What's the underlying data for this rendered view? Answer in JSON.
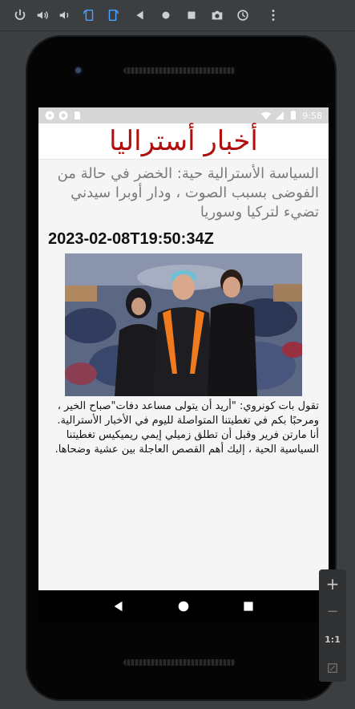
{
  "status_bar": {
    "time": "9:58"
  },
  "app": {
    "title": "أخبار أستراليا"
  },
  "article": {
    "headline": "السياسة الأسترالية حية: الخضر في حالة من الفوضى بسبب الصوت ، ودار أوبرا سيدني تضيء لتركيا وسوريا",
    "timestamp": "2023-02-08T19:50:34Z",
    "body": "تقول بات كونروي: \"أريد أن يتولى مساعد دفات\"صباح الخير ، ومرحبًا بكم في تغطيتنا المتواصلة لليوم في الأخبار الأسترالية. أنا مارتن فرير وقبل أن تطلق زميلي إيمي ريميكيس تغطيتنا السياسية الحية ، إليك أهم القصص العاجلة بين عشية وضحاها."
  },
  "zoom_panel": {
    "plus": "+",
    "minus": "−",
    "ratio": "1:1"
  },
  "colors": {
    "title_red": "#b10e0e",
    "headline_gray": "#7a7a7a"
  }
}
